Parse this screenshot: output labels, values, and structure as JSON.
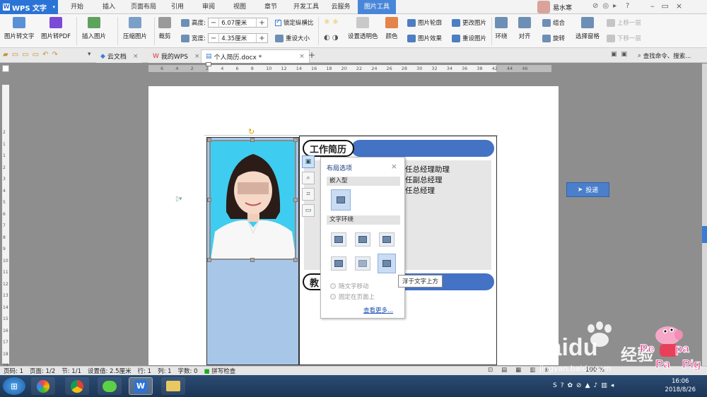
{
  "app": {
    "logo": "WPS 文字",
    "user": "易水寒",
    "help": "?"
  },
  "menu": [
    "开始",
    "插入",
    "页面布局",
    "引用",
    "审阅",
    "视图",
    "章节",
    "开发工具",
    "云服务",
    "图片工具"
  ],
  "ribbon": {
    "pic_to_text": "图片转文字",
    "pic_to_pdf": "图片转PDF",
    "insert_pic": "插入图片",
    "compress": "压缩图片",
    "crop": "裁剪",
    "height_label": "高度:",
    "height_value": "6.07厘米",
    "width_label": "宽度:",
    "width_value": "4.35厘米",
    "lock_ratio": "锁定纵横比",
    "reset_size": "重设大小",
    "transparent": "设置透明色",
    "color": "颜色",
    "outline": "图片轮廓",
    "effect": "图片效果",
    "change": "更改图片",
    "reset_pic": "重设图片",
    "wrap": "环绕",
    "align": "对齐",
    "rotate": "旋转",
    "group": "组合",
    "pane": "选择窗格",
    "up": "上移一层",
    "down": "下移一层"
  },
  "tabs": [
    {
      "label": "云文档"
    },
    {
      "label": "我的WPS"
    },
    {
      "label": "个人简历.docx *"
    }
  ],
  "search": {
    "label": "查找命令、搜索..."
  },
  "ruler_h": [
    "6",
    "4",
    "2",
    "2",
    "4",
    "6",
    "8",
    "10",
    "12",
    "14",
    "16",
    "18",
    "20",
    "22",
    "24",
    "26",
    "28",
    "30",
    "32",
    "34",
    "36",
    "38",
    "42",
    "44",
    "46"
  ],
  "ruler_v": [
    "2",
    "1",
    "1",
    "2",
    "3",
    "4",
    "5",
    "6",
    "7",
    "8",
    "9",
    "10",
    "11",
    "12",
    "13",
    "14",
    "15",
    "16",
    "17",
    "18",
    "19",
    "20",
    "21"
  ],
  "doc": {
    "section1": "工作简历",
    "section2": "教",
    "jobs": [
      "任总经理助理",
      "任副总经理",
      "任总经理"
    ]
  },
  "layout_popup": {
    "title": "布局选项",
    "close": "×",
    "inline": "嵌入型",
    "wrap": "文字环绕",
    "move_with_text": "随文字移动",
    "fix_on_page": "固定在页面上",
    "see_more": "查看更多..."
  },
  "tooltip": "浮于文字上方",
  "submit": "投递",
  "status": {
    "page": "页码: 1",
    "pages": "页面: 1/2",
    "section": "节: 1/1",
    "setting": "设置值: 2.5厘米",
    "row": "行: 1",
    "col": "列: 1",
    "words": "字数: 0",
    "spell": "拼写检查",
    "zoom": "100 %"
  },
  "clock": {
    "time": "16:06",
    "date": "2018/8/26"
  },
  "watermark": {
    "brand": "Bai",
    "brand2": "du",
    "jingyan": "经验",
    "url": "jingyan.baidu.com"
  }
}
